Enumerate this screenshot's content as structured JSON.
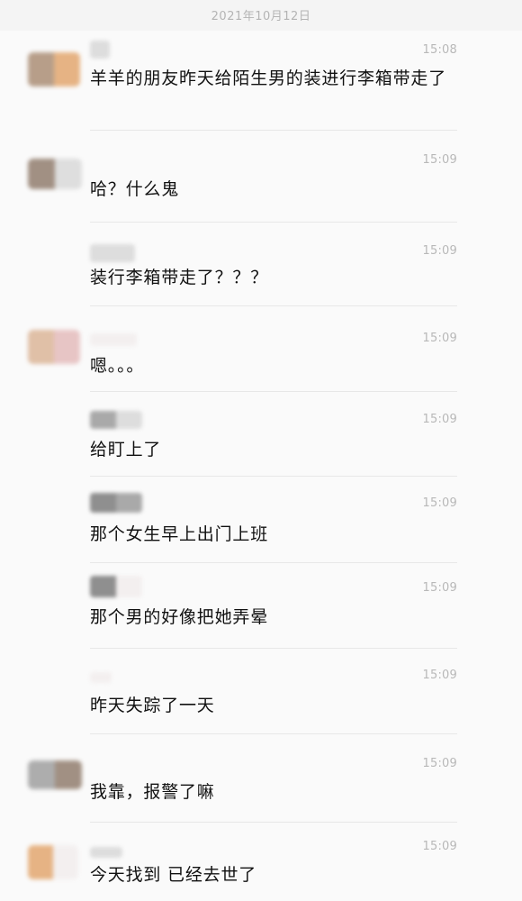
{
  "header": {
    "date": "2021年10月12日"
  },
  "messages": [
    {
      "time": "15:08",
      "text": "羊羊的朋友昨天给陌生男的装进行李箱带走了"
    },
    {
      "time": "15:09",
      "text": "哈？什么鬼"
    },
    {
      "time": "15:09",
      "text": "装行李箱带走了？？？"
    },
    {
      "time": "15:09",
      "text": "嗯。。。"
    },
    {
      "time": "15:09",
      "text": "给盯上了"
    },
    {
      "time": "15:09",
      "text": "那个女生早上出门上班"
    },
    {
      "time": "15:09",
      "text": "那个男的好像把她弄晕"
    },
    {
      "time": "15:09",
      "text": "昨天失踪了一天"
    },
    {
      "time": "15:09",
      "text": "我靠，报警了嘛"
    },
    {
      "time": "15:09",
      "text": "今天找到 已经去世了"
    }
  ]
}
